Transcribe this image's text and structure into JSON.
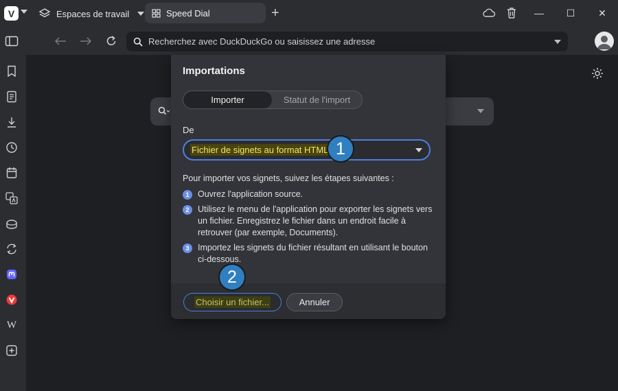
{
  "browser": {
    "workspaces_label": "Espaces de travail",
    "tab_title": "Speed Dial",
    "new_tab_symbol": "+",
    "address_placeholder": "Recherchez avec DuckDuckGo ou saisissez une adresse",
    "vivaldi_logo_letter": "V"
  },
  "window_controls": {
    "minimize": "—",
    "maximize": "☐",
    "close": "✕"
  },
  "sidebar": {
    "items": [
      {
        "name": "bookmarks-icon"
      },
      {
        "name": "reading-list-icon"
      },
      {
        "name": "downloads-icon"
      },
      {
        "name": "history-icon"
      },
      {
        "name": "calendar-icon"
      },
      {
        "name": "translate-icon"
      },
      {
        "name": "window-panel-icon"
      },
      {
        "name": "sync-icon"
      },
      {
        "name": "mastodon-icon"
      },
      {
        "name": "vivaldi-icon"
      },
      {
        "name": "wikipedia-icon"
      },
      {
        "name": "add-panel-icon"
      }
    ],
    "wikipedia_letter": "W"
  },
  "dialog": {
    "title": "Importations",
    "tabs": {
      "import": "Importer",
      "status": "Statut de l'import"
    },
    "from_label": "De",
    "source_value": "Fichier de signets au format HTML",
    "intro": "Pour importer vos signets, suivez les étapes suivantes :",
    "steps": [
      {
        "num": "1",
        "text": "Ouvrez l'application source."
      },
      {
        "num": "2",
        "text": "Utilisez le menu de l'application pour exporter les signets vers un fichier. Enregistrez le fichier dans un endroit facile à retrouver (par exemple, Documents)."
      },
      {
        "num": "3",
        "text": "Importez les signets du fichier résultant en utilisant le bouton ci-dessous."
      }
    ],
    "choose_file": "Choisir un fichier...",
    "cancel": "Annuler"
  },
  "callouts": {
    "first": "1",
    "second": "2"
  },
  "colors": {
    "accent": "#4f7fe0",
    "callout": "#2f7fc1",
    "highlight_text": "#f5e66a"
  }
}
